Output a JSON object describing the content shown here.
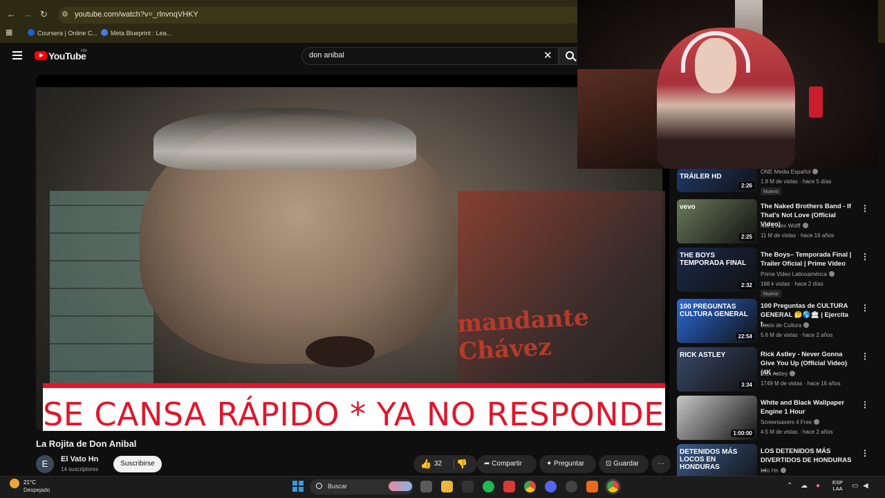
{
  "browser": {
    "url": "youtube.com/watch?v=_rlnvnqVHKY",
    "bookmarks": [
      "Coursera | Online C...",
      "Meta Blueprint : Lea..."
    ]
  },
  "youtube": {
    "logo_text": "YouTube",
    "region": "HN",
    "search_value": "don anibal"
  },
  "video": {
    "banner_text": "SE CANSA RÁPIDO  * YA NO  RESPONDE",
    "background_sign": "mandante Chávez",
    "title": "La Rojita de Don Anibal",
    "channel": {
      "avatar_letter": "E",
      "name": "El Vato Hn",
      "subscribers": "14 suscriptores",
      "subscribe_label": "Suscribirse"
    },
    "actions": {
      "likes": "32",
      "share": "Compartir",
      "ask": "Preguntar",
      "save": "Guardar"
    }
  },
  "recommendations": [
    {
      "title": "",
      "channel": "ONE Media Español",
      "meta": "1.8 M de vistas · hace 5 días",
      "badge": "Nuevo",
      "duration": "2:26",
      "thumb_text": "TRÁILER HD",
      "thumb_color": "#1f3a6a"
    },
    {
      "title": "The Naked Brothers Band - If That's Not Love (Official Video)",
      "channel": "Nat & Alex Wolff",
      "meta": "11 M de vistas · hace 16 años",
      "badge": "",
      "duration": "2:25",
      "thumb_text": "vevo",
      "thumb_color": "#6a7a5a"
    },
    {
      "title": "The Boys– Temporada Final | Trailer Oficial | Prime Video",
      "channel": "Prime Video Latinoamérica",
      "meta": "168 k vistas · hace 2 días",
      "badge": "Nuevo",
      "duration": "2:32",
      "thumb_text": "THE BOYS TEMPORADA FINAL",
      "thumb_color": "#1a2a4a"
    },
    {
      "title": "100 Preguntas de CULTURA GENERAL 🤔🌎🏛 | Ejercita t...",
      "channel": "Dosis de Cultura",
      "meta": "5.6 M de vistas · hace 2 años",
      "badge": "",
      "duration": "22:54",
      "thumb_text": "100 PREGUNTAS CULTURA GENERAL",
      "thumb_color": "#2a6ad8"
    },
    {
      "title": "Rick Astley - Never Gonna Give You Up (Official Video) (4K ...",
      "channel": "Rick Astley",
      "meta": "1749 M de vistas · hace 16 años",
      "badge": "",
      "duration": "3:34",
      "thumb_text": "RICK ASTLEY",
      "thumb_color": "#3a4a6a"
    },
    {
      "title": "White and Black Wallpaper Engine 1 Hour",
      "channel": "Screensavers 4 Free",
      "meta": "4.5 M de vistas · hace 2 años",
      "badge": "",
      "duration": "1:00:00",
      "thumb_text": "",
      "thumb_color": "#c8c8c8"
    },
    {
      "title": "LOS DETENIDOS MÁS DIVERTIDOS DE HONDURAS ...",
      "channel": "Info Hn",
      "meta": "",
      "badge": "",
      "duration": "",
      "thumb_text": "DETENIDOS MÁS LOCOS EN HONDURAS",
      "thumb_color": "#3a5a8a"
    }
  ],
  "taskbar": {
    "temperature": "21°C",
    "condition": "Despejado",
    "search_placeholder": "Buscar",
    "lang_top": "ESP",
    "lang_bottom": "LAA"
  }
}
